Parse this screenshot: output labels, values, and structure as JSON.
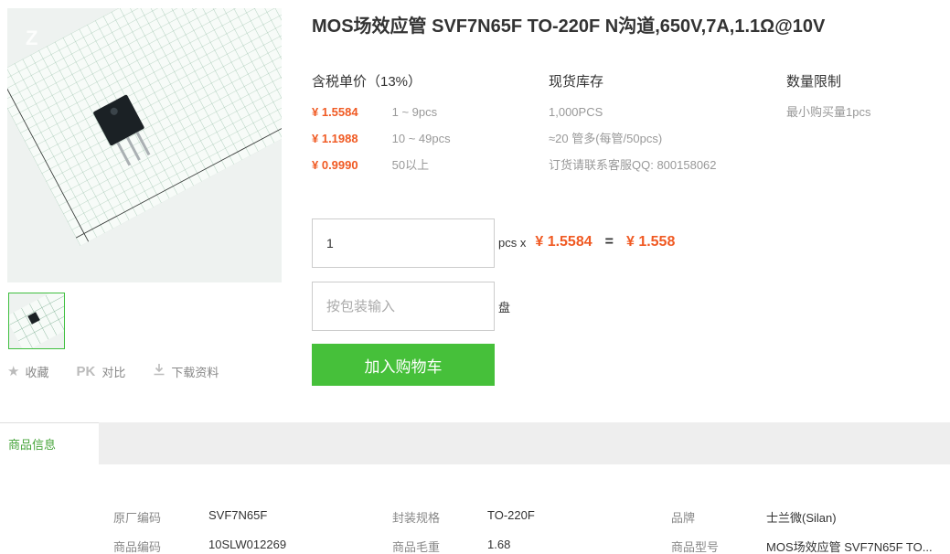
{
  "watermark": "Z",
  "product": {
    "title": "MOS场效应管 SVF7N65F TO-220F N沟道,650V,7A,1.1Ω@10V"
  },
  "actions": {
    "favorite_label": "收藏",
    "pk_label": "PK",
    "compare_label": "对比",
    "download_label": "下载资料"
  },
  "pricing": {
    "header": "含税单价（13%）",
    "tiers": [
      {
        "price": "¥ 1.5584",
        "range": "1 ~ 9pcs"
      },
      {
        "price": "¥ 1.1988",
        "range": "10 ~ 49pcs"
      },
      {
        "price": "¥ 0.9990",
        "range": "50以上"
      }
    ]
  },
  "stock": {
    "header": "现货库存",
    "lines": [
      "1,000PCS",
      "≈20 管多(每管/50pcs)",
      "订货请联系客服QQ: 800158062"
    ]
  },
  "limit": {
    "header": "数量限制",
    "text": "最小购买量1pcs"
  },
  "order": {
    "quantity_value": "1",
    "unit_label": "pcs x",
    "unit_price": "¥ 1.5584",
    "equals": "=",
    "total": "¥ 1.558",
    "pan_placeholder": "按包装输入",
    "pan_unit": "盘",
    "cart_button": "加入购物车"
  },
  "tabs": {
    "product_info": "商品信息"
  },
  "specs": {
    "col1": [
      {
        "key": "原厂编码",
        "value": "SVF7N65F"
      },
      {
        "key": "商品编码",
        "value": "10SLW012269"
      }
    ],
    "col2": [
      {
        "key": "封装规格",
        "value": "TO-220F"
      },
      {
        "key": "商品毛重",
        "value": "1.68"
      }
    ],
    "col3": [
      {
        "key": "品牌",
        "value": "士兰微(Silan)"
      },
      {
        "key": "商品型号",
        "value": "MOS场效应管 SVF7N65F TO..."
      }
    ]
  },
  "colors": {
    "accent_green": "#46c03a",
    "price_orange": "#f05a23"
  }
}
